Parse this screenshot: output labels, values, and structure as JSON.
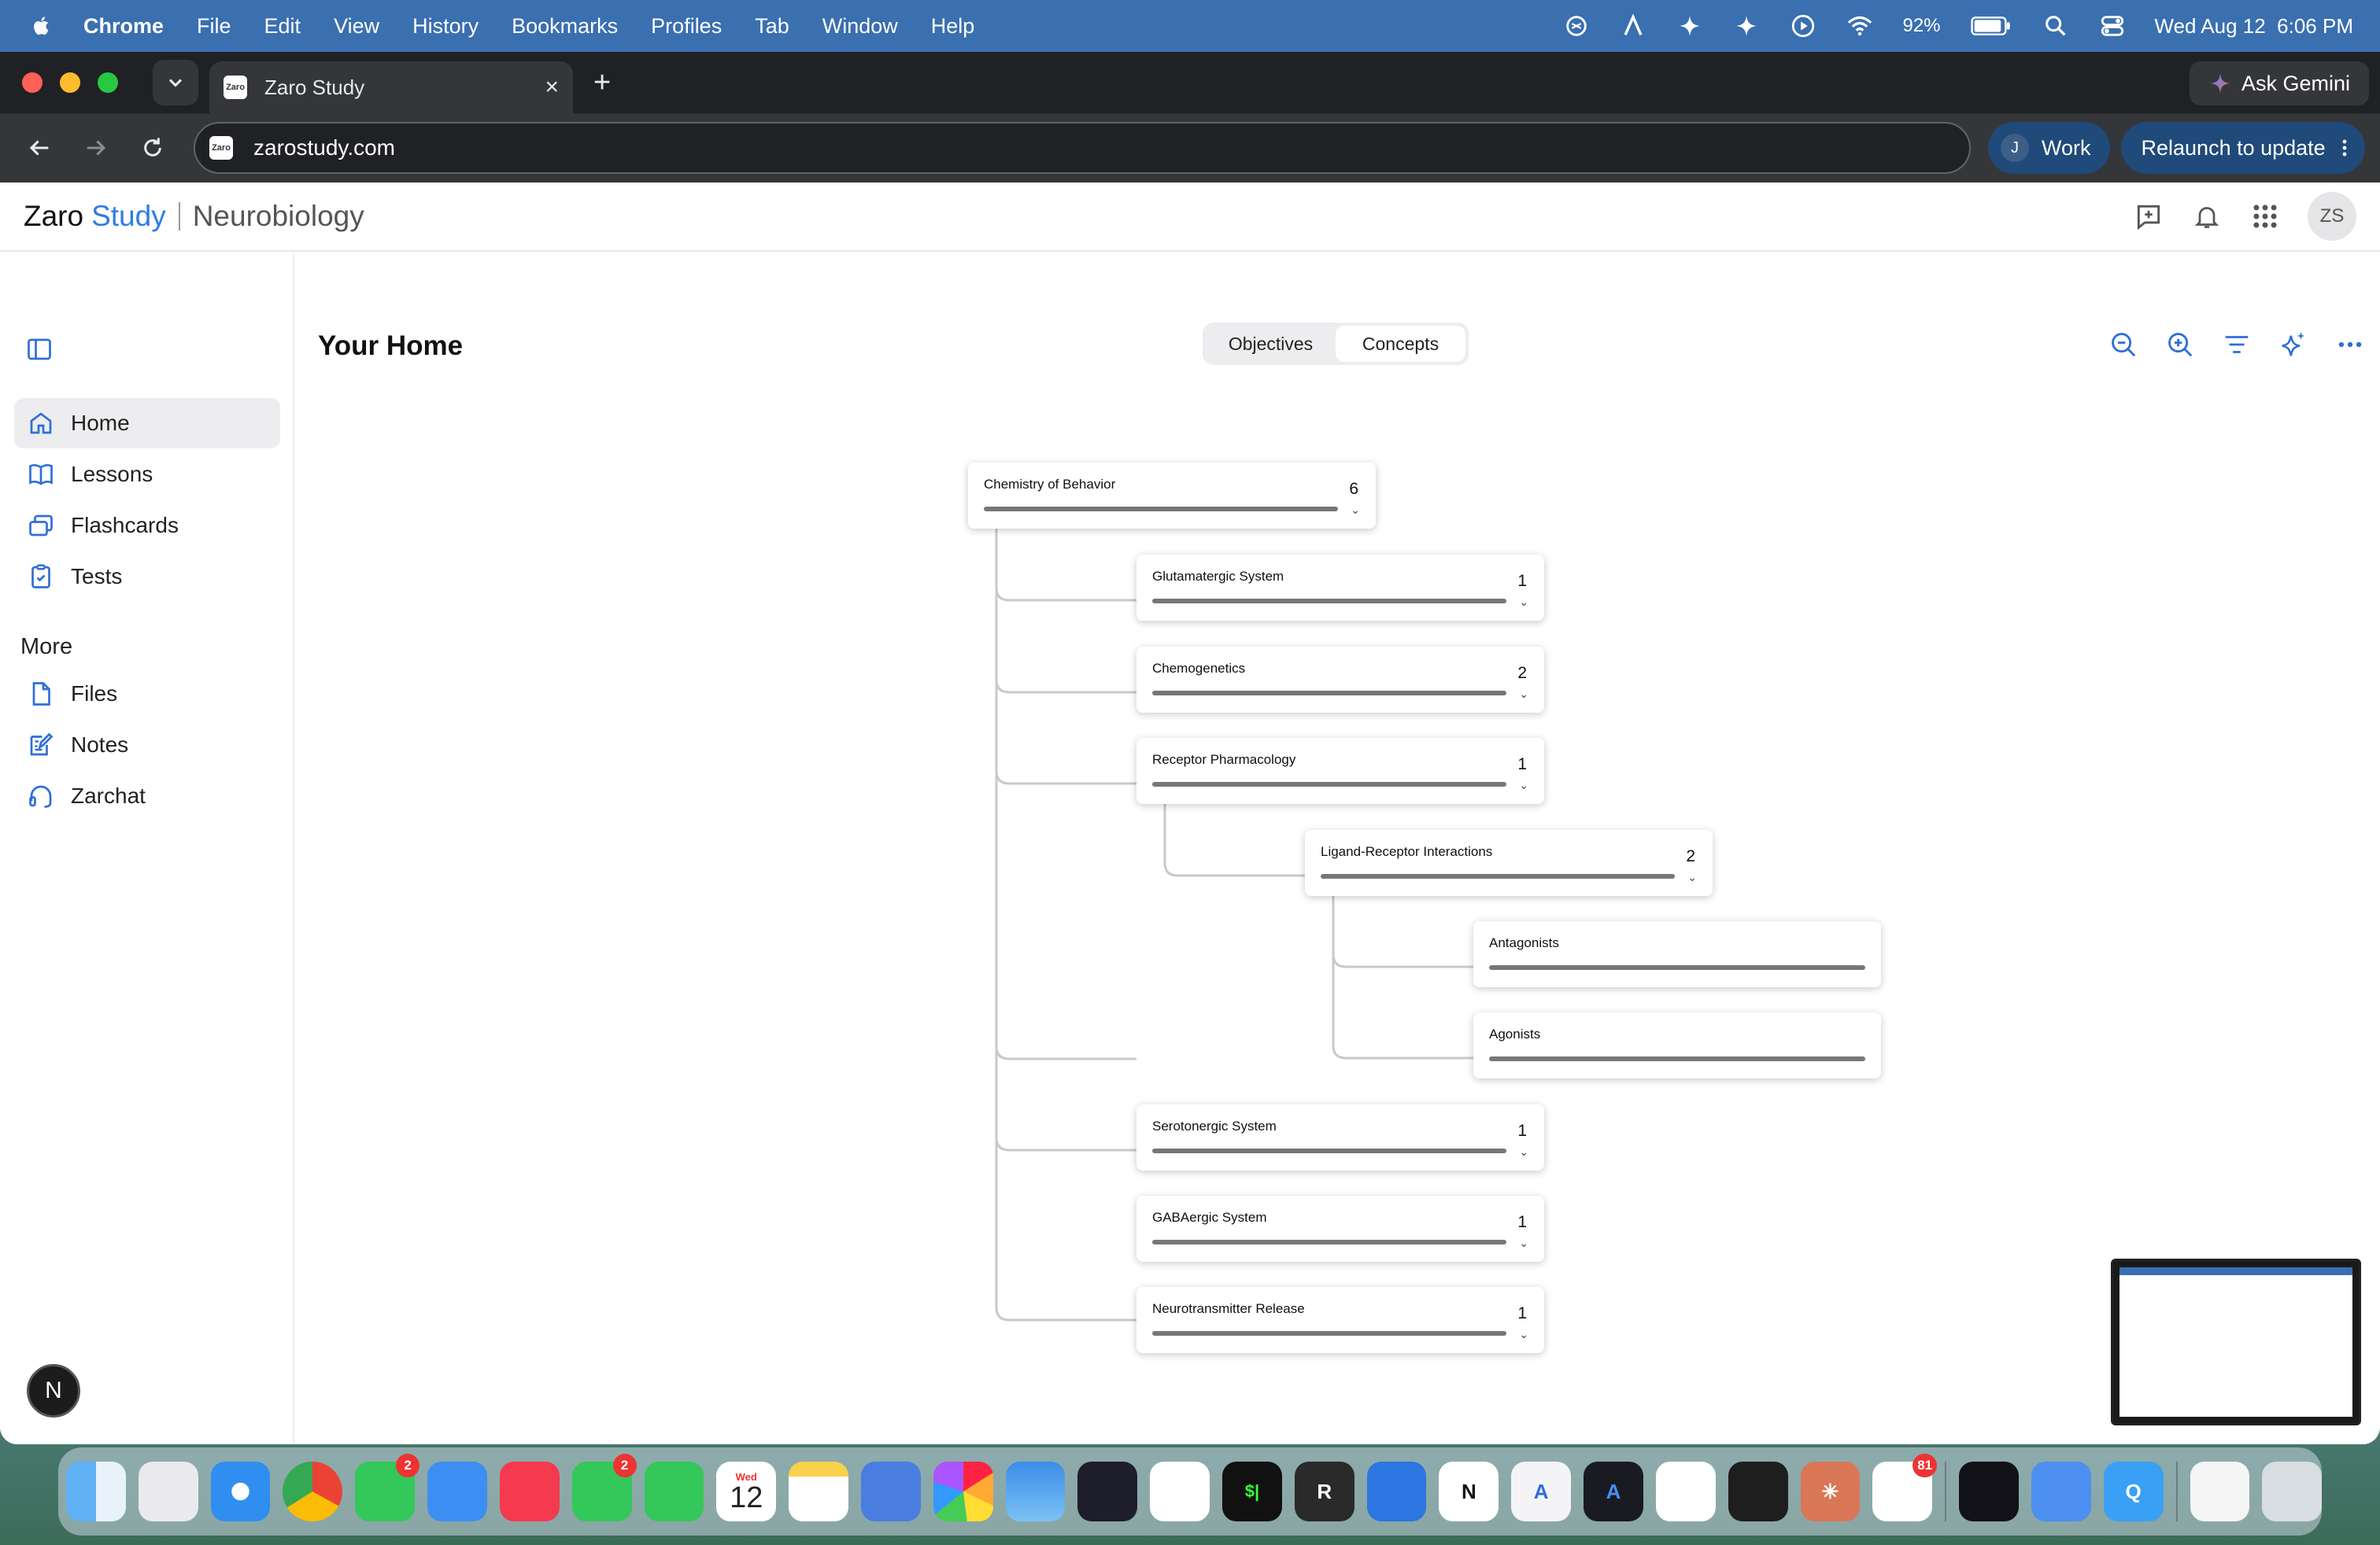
{
  "menubar": {
    "app": "Chrome",
    "items": [
      "File",
      "Edit",
      "View",
      "History",
      "Bookmarks",
      "Profiles",
      "Tab",
      "Window",
      "Help"
    ],
    "battery": "92%",
    "datetime": "Wed Aug 12  6:06 PM"
  },
  "browser": {
    "tab_title": "Zaro Study",
    "favicon_text": "Zaro",
    "url": "zarostudy.com",
    "ask_gemini": "Ask Gemini",
    "profile_initial": "J",
    "profile_label": "Work",
    "relaunch": "Relaunch to update"
  },
  "app": {
    "brand_1": "Zaro",
    "brand_2": "Study",
    "course": "Neurobiology",
    "avatar": "ZS"
  },
  "sidebar": {
    "items": [
      {
        "label": "Home",
        "icon": "home-icon"
      },
      {
        "label": "Lessons",
        "icon": "book-icon"
      },
      {
        "label": "Flashcards",
        "icon": "cards-icon"
      },
      {
        "label": "Tests",
        "icon": "clipboard-icon"
      }
    ],
    "more_title": "More",
    "more_items": [
      {
        "label": "Files",
        "icon": "file-icon"
      },
      {
        "label": "Notes",
        "icon": "notes-icon"
      },
      {
        "label": "Zarchat",
        "icon": "headset-icon"
      }
    ],
    "bottom_badge": "N"
  },
  "main": {
    "title": "Your Home",
    "segments": [
      "Objectives",
      "Concepts"
    ],
    "active_segment": "Concepts"
  },
  "tree": {
    "root": {
      "label": "Chemistry of Behavior",
      "count": "6"
    },
    "nodes": [
      {
        "label": "Glutamatergic System",
        "count": "1"
      },
      {
        "label": "Chemogenetics",
        "count": "2"
      },
      {
        "label": "Receptor Pharmacology",
        "count": "1"
      },
      {
        "label": "Ligand-Receptor Interactions",
        "count": "2"
      },
      {
        "label": "Antagonists",
        "count": ""
      },
      {
        "label": "Agonists",
        "count": ""
      },
      {
        "label": "Serotonergic System",
        "count": "1"
      },
      {
        "label": "GABAergic System",
        "count": "1"
      },
      {
        "label": "Neurotransmitter Release",
        "count": "1"
      }
    ]
  },
  "dock": {
    "calendar_month": "Wed",
    "calendar_day": "12",
    "messages_badge": "2",
    "facetime_badge": "2",
    "chatgpt_badge": "81"
  }
}
